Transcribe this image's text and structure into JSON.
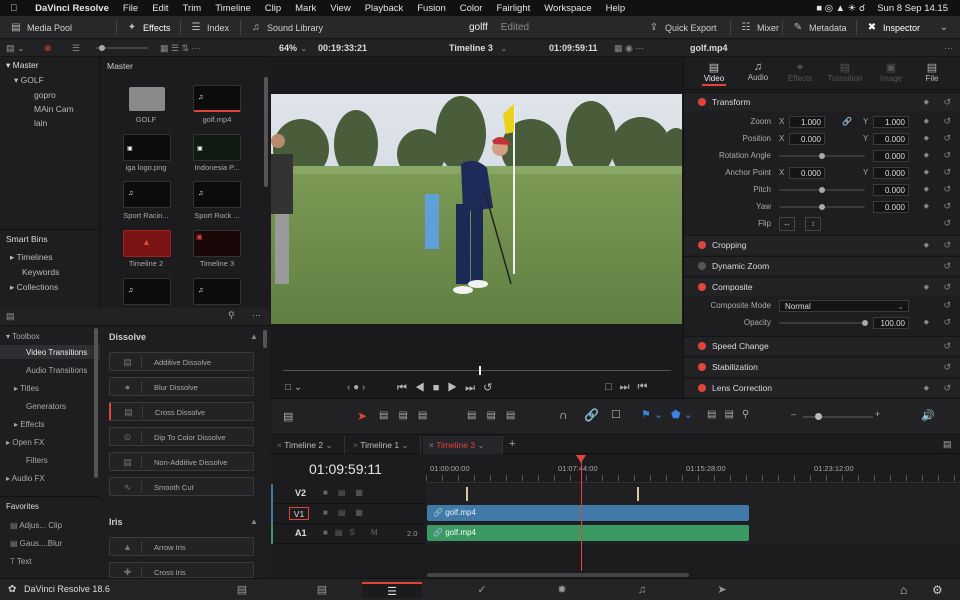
{
  "menubar": {
    "app": "DaVinci Resolve",
    "items": [
      "File",
      "Edit",
      "Trim",
      "Timeline",
      "Clip",
      "Mark",
      "View",
      "Playback",
      "Fusion",
      "Color",
      "Fairlight",
      "Workspace",
      "Help"
    ],
    "datetime": "Sun 8 Sep  14.15"
  },
  "toolbar": {
    "media_pool": "Media Pool",
    "effects": "Effects",
    "index": "Index",
    "sound_library": "Sound Library",
    "project_title": "golff",
    "project_status": "Edited",
    "quick_export": "Quick Export",
    "mixer": "Mixer",
    "metadata": "Metadata",
    "inspector": "Inspector"
  },
  "subbar": {
    "zoom": "64%",
    "source_timecode": "00:19:33:21",
    "timeline_name": "Timeline 3",
    "record_timecode": "01:09:59:11",
    "clip_name": "golf.mp4"
  },
  "bins": {
    "master": "Master",
    "items": [
      "GOLF",
      "gopro",
      "MAin Cam",
      "lain"
    ],
    "smart_bins_title": "Smart Bins",
    "smart_bins": [
      "Timelines",
      "Keywords",
      "Collections"
    ]
  },
  "media": {
    "header": "Master",
    "clips": [
      {
        "name": "GOLF"
      },
      {
        "name": "golf.mp4"
      },
      {
        "name": "iga logo.png"
      },
      {
        "name": "Indonesia P..."
      },
      {
        "name": "Sport Racin..."
      },
      {
        "name": "Sport Rock ..."
      },
      {
        "name": "Timeline 2"
      },
      {
        "name": "Timeline 3"
      },
      {
        "name": ""
      },
      {
        "name": ""
      }
    ]
  },
  "toolbox": {
    "items": [
      {
        "label": "Toolbox",
        "level": 0
      },
      {
        "label": "Video Transitions",
        "level": 1,
        "selected": true
      },
      {
        "label": "Audio Transitions",
        "level": 1
      },
      {
        "label": "Titles",
        "level": 1
      },
      {
        "label": "Generators",
        "level": 1
      },
      {
        "label": "Effects",
        "level": 1
      },
      {
        "label": "Open FX",
        "level": 0
      },
      {
        "label": "Filters",
        "level": 1
      },
      {
        "label": "Audio FX",
        "level": 0
      }
    ],
    "favorites_title": "Favorites",
    "favorites": [
      "Adjus... Clip",
      "Gaus....Blur",
      "Text"
    ]
  },
  "effects": {
    "dissolve_title": "Dissolve",
    "dissolve": [
      "Additive Dissolve",
      "Blur Dissolve",
      "Cross Dissolve",
      "Dip To Color Dissolve",
      "Non-Additive Dissolve",
      "Smooth Cut"
    ],
    "iris_title": "Iris",
    "iris": [
      "Arrow Iris",
      "Cross Iris"
    ]
  },
  "inspector": {
    "tabs": [
      "Video",
      "Audio",
      "Effects",
      "Transition",
      "Image",
      "File"
    ],
    "transform_title": "Transform",
    "zoom_label": "Zoom",
    "zoom_x": "1.000",
    "zoom_y": "1.000",
    "position_label": "Position",
    "position_x": "0.000",
    "position_y": "0.000",
    "rotation_label": "Rotation Angle",
    "rotation": "0.000",
    "anchor_label": "Anchor Point",
    "anchor_x": "0.000",
    "anchor_y": "0.000",
    "pitch_label": "Pitch",
    "pitch": "0.000",
    "yaw_label": "Yaw",
    "yaw": "0.000",
    "flip_label": "Flip",
    "cropping": "Cropping",
    "dynamic_zoom": "Dynamic Zoom",
    "composite": "Composite",
    "composite_mode_label": "Composite Mode",
    "composite_mode": "Normal",
    "opacity_label": "Opacity",
    "opacity": "100.00",
    "speed_change": "Speed Change",
    "stabilization": "Stabilization",
    "lens_correction": "Lens Correction"
  },
  "timeline": {
    "tabs": [
      "Timeline 2",
      "Timeline 1",
      "Timeline 3"
    ],
    "timecode": "01:09:59:11",
    "ruler": [
      "01:00:00:00",
      "01:07:44:00",
      "01:15:28:00",
      "01:23:12:00"
    ],
    "tracks": [
      {
        "name": "V2"
      },
      {
        "name": "V1"
      },
      {
        "name": "A1",
        "level": "2.0"
      }
    ],
    "video_clip": "golf.mp4",
    "audio_clip": "golf.mp4",
    "playhead_fraction": 0.29
  },
  "footer": {
    "app_version": "DaVinci Resolve 18.6"
  },
  "colors": {
    "accent_red": "#e0443a",
    "video_clip": "#3f7aa8",
    "audio_clip": "#3b9a63"
  }
}
